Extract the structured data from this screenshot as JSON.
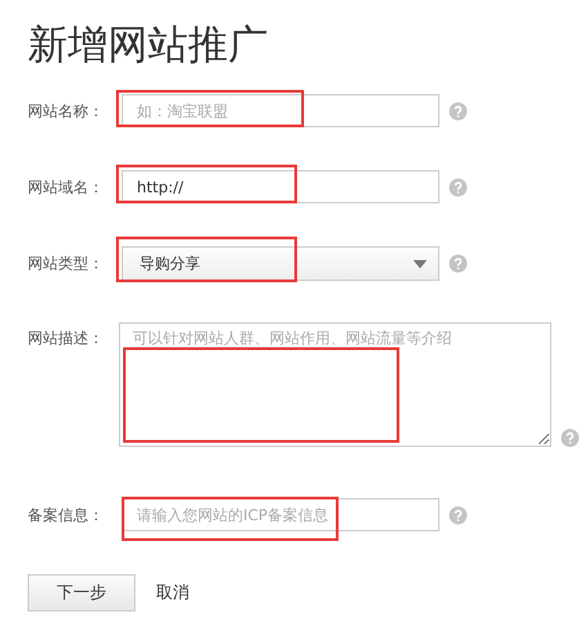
{
  "title": "新增网站推广",
  "fields": [
    {
      "label": "网站名称：",
      "kind": "text",
      "placeholder": "如：淘宝联盟",
      "highlighted": true
    },
    {
      "label": "网站域名：",
      "kind": "text",
      "value": "http://",
      "highlighted": true
    },
    {
      "label": "网站类型：",
      "kind": "select",
      "value": "导购分享",
      "highlighted": true
    },
    {
      "label": "网站描述：",
      "kind": "textarea",
      "placeholder": "可以针对网站人群、网站作用、网站流量等介绍",
      "highlighted": true
    },
    {
      "label": "备案信息：",
      "kind": "text",
      "placeholder": "请输入您网站的ICP备案信息",
      "highlighted": true
    }
  ],
  "buttons": {
    "next": "下一步",
    "cancel": "取消"
  }
}
